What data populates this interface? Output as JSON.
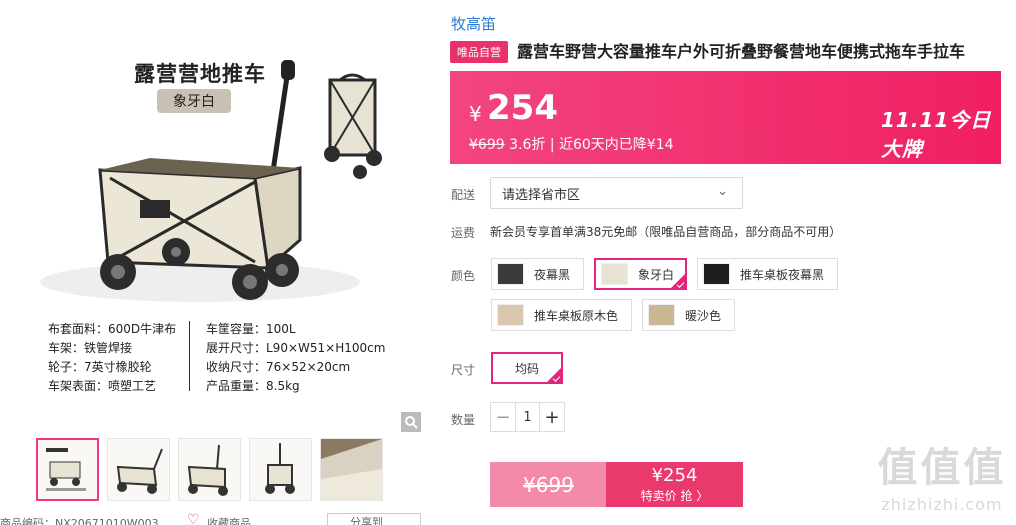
{
  "image": {
    "title": "露营营地推车",
    "color_tag": "象牙白",
    "specs_left": [
      "布套面料：600D牛津布",
      "车架：铁管焊接",
      "轮子：7英寸橡胶轮",
      "车架表面：喷塑工艺"
    ],
    "specs_right": [
      "车筐容量：100L",
      "展开尺寸：L90×W51×H100cm",
      "收纳尺寸：76×52×20cm",
      "产品重量：8.5kg"
    ],
    "bottom_code": "商品编码：NX20671010W003",
    "favorite": "收藏商品",
    "share": "分享到"
  },
  "product": {
    "brand": "牧高笛",
    "badge": "唯品自营",
    "title": "露营车野营大容量推车户外可折叠野餐营地车便携式拖车手拉车"
  },
  "price": {
    "currency": "¥",
    "value": "254",
    "original": "¥699",
    "discount": "3.6折",
    "history": "| 近60天内已降¥14",
    "promo": "11.11今日大牌"
  },
  "delivery": {
    "label": "配送",
    "placeholder": "请选择省市区"
  },
  "shipping": {
    "label": "运费",
    "text": "新会员专享首单满38元免邮（限唯品自营商品，部分商品不可用）"
  },
  "colors": {
    "label": "颜色",
    "options": [
      "夜幕黑",
      "象牙白",
      "推车桌板夜幕黑",
      "推车桌板原木色",
      "暖沙色"
    ],
    "selected": "象牙白"
  },
  "size": {
    "label": "尺寸",
    "option": "均码"
  },
  "quantity": {
    "label": "数量",
    "value": "1",
    "minus": "−",
    "plus": "+"
  },
  "buy": {
    "original": "¥699",
    "price": "¥254",
    "cta": "特卖价 抢 〉"
  },
  "watermark": {
    "glyphs": "值值值",
    "url": "zhizhizhi.com"
  },
  "colors_hex": {
    "accent": "#e8326a",
    "link": "#2b7bd6"
  }
}
